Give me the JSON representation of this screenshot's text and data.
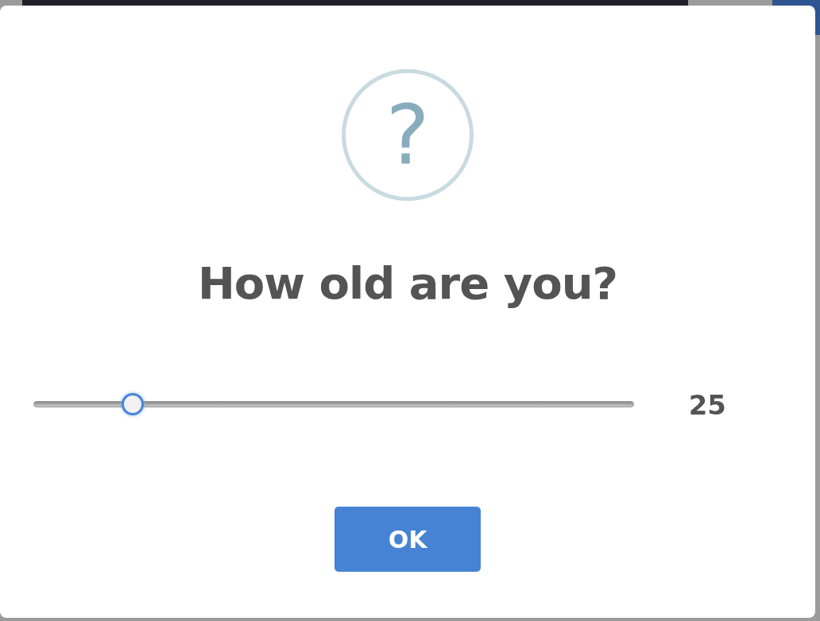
{
  "dialog": {
    "icon_glyph": "?",
    "title": "How old are you?",
    "slider": {
      "level": 0.165,
      "reading": "25"
    },
    "buttons": [
      {
        "label": "OK",
        "kind": "confirm"
      }
    ]
  }
}
